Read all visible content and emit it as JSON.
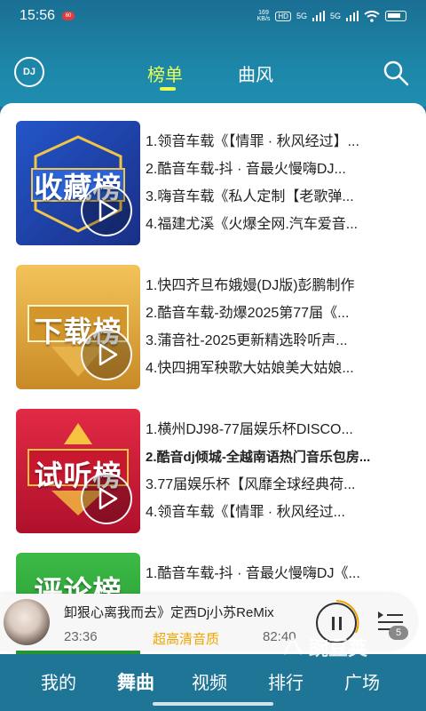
{
  "status_bar": {
    "time": "15:56",
    "net_speed_value": "169",
    "net_speed_unit": "KB/s",
    "signal_badge": "HD",
    "signal_1": "5G",
    "signal_2": "5G"
  },
  "header": {
    "logo_text": "DJ",
    "tabs": [
      {
        "label": "榜单",
        "active": true
      },
      {
        "label": "曲风",
        "active": false
      }
    ]
  },
  "charts": [
    {
      "cover_title": "收藏榜",
      "colors": [
        "#1c3ea8",
        "#1a2a6e"
      ],
      "tracks": [
        "1.领音车载《【情罪 · 秋风经过】...",
        "2.酷音车载-抖 · 音最火慢嗨DJ...",
        "3.嗨音车载《私人定制【老歌弹...",
        "4.福建尤溪《火爆全网.汽车爱音..."
      ]
    },
    {
      "cover_title": "下载榜",
      "colors": [
        "#e0a63a",
        "#b77a1c"
      ],
      "tracks": [
        "1.快四齐旦布娥嫚(DJ版)彭鹏制作",
        "2.酷音车载-劲爆2025第77届《...",
        "3.蒲音社-2025更新精选聆听声...",
        "4.快四拥军秧歌大姑娘美大姑娘..."
      ]
    },
    {
      "cover_title": "试听榜",
      "colors": [
        "#d8203a",
        "#a8102a"
      ],
      "tracks": [
        "1.横州DJ98-77届娱乐杯DISCO...",
        "2.酷音dj倾城-全越南语热门音乐包房...",
        "3.77届娱乐杯【风靡全球经典荷...",
        "4.领音车载《【情罪 · 秋风经过..."
      ],
      "bold_index": 1
    },
    {
      "cover_title": "评论榜",
      "colors": [
        "#2faa3a",
        "#1d8a2a"
      ],
      "tracks": [
        "1.酷音车载-抖 · 音最火慢嗨DJ《..."
      ]
    }
  ],
  "player": {
    "title": "卸狠心离我而去》定西Dj小苏ReMix",
    "current_time": "23:36",
    "quality": "超高清音质",
    "total_time": "82:40",
    "queue_count": "5"
  },
  "bottom_nav": [
    {
      "label": "我的",
      "active": false
    },
    {
      "label": "舞曲",
      "active": true
    },
    {
      "label": "视频",
      "active": false
    },
    {
      "label": "排行",
      "active": false
    },
    {
      "label": "广场",
      "active": false
    }
  ],
  "watermark": "豌豆荚"
}
